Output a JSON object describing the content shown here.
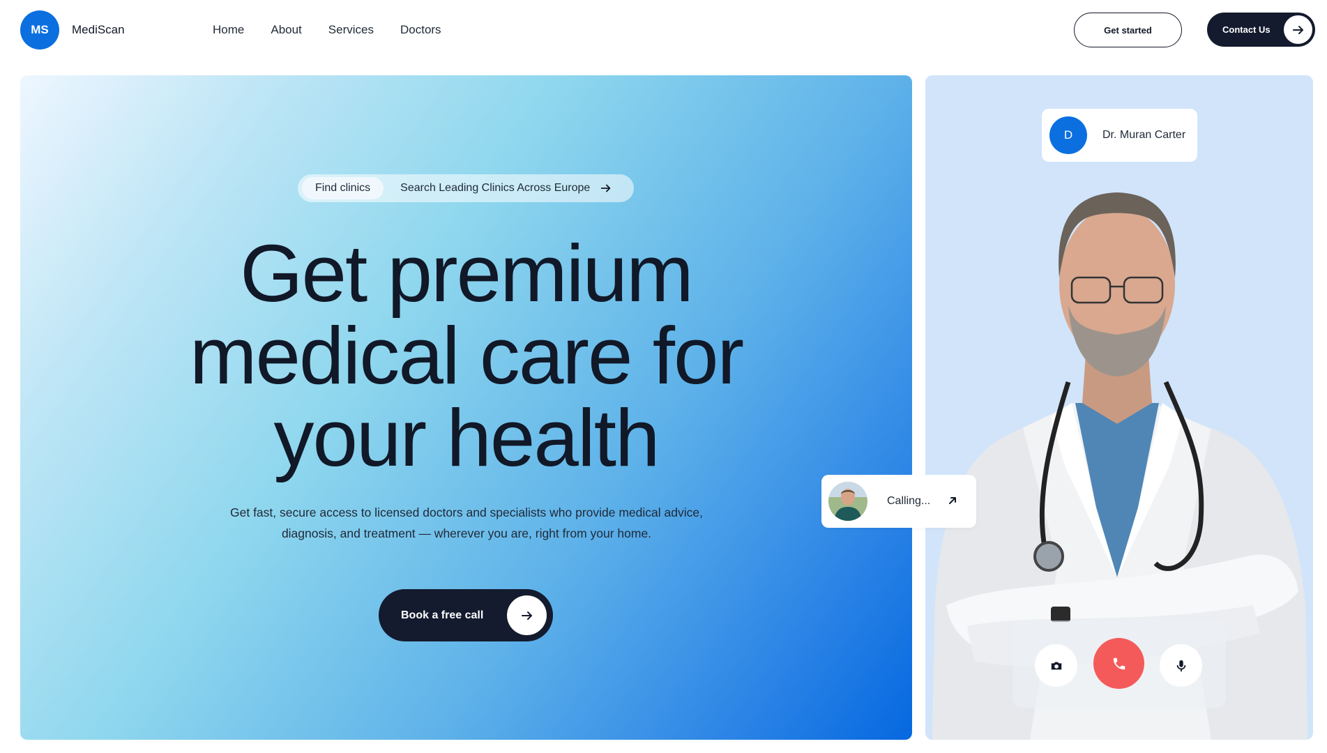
{
  "brand": {
    "logo_initials": "MS",
    "name": "MediScan"
  },
  "nav": {
    "items": [
      "Home",
      "About",
      "Services",
      "Doctors"
    ]
  },
  "header": {
    "get_started_label": "Get started",
    "contact_label": "Contact Us"
  },
  "hero": {
    "pill_tag": "Find clinics",
    "pill_text": "Search Leading Clinics Across Europe",
    "title_lines": [
      "Get premium",
      "medical care for",
      "your health"
    ],
    "subtitle_line1": "Get fast, secure access to licensed doctors and specialists who provide medical advice,",
    "subtitle_line2": "diagnosis, and treatment — wherever you are, right from your home.",
    "cta_label": "Book a free call"
  },
  "doctor": {
    "avatar_initial": "D",
    "name": "Dr. Muran Carter"
  },
  "call": {
    "status": "Calling..."
  },
  "colors": {
    "brand_blue": "#0b6fe0",
    "dark_navy": "#141b2e",
    "end_call_red": "#f55a5a",
    "doctor_panel_bg": "#d1e4fa"
  },
  "icons": {
    "pill_arrow": "arrow-right-icon",
    "cta_arrow": "arrow-right-icon",
    "calling_arrow": "arrow-up-right-icon",
    "camera": "camera-icon",
    "end_call": "phone-icon",
    "mic": "microphone-icon"
  }
}
